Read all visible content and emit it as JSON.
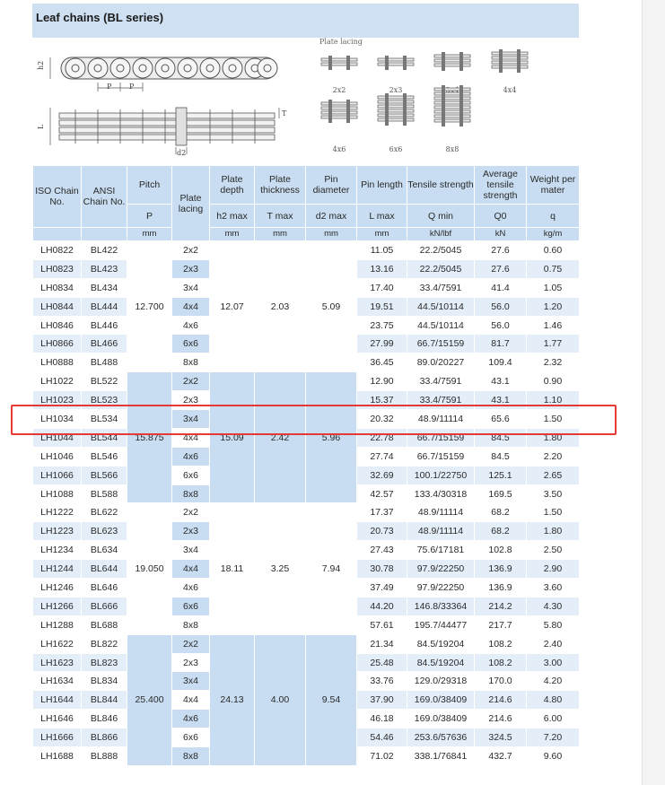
{
  "title": "Leaf chains (BL series)",
  "plate_lacing_title": "Plate lacing",
  "lacing_types": [
    "2x2",
    "2x3",
    "3x4",
    "4x4",
    "4x6",
    "6x6",
    "8x8"
  ],
  "dimension_labels": {
    "h2": "h2",
    "p1": "P",
    "p2": "P",
    "l": "L",
    "t": "T",
    "d2": "d2"
  },
  "headers": {
    "row1": [
      "ISO Chain No.",
      "ANSI Chain No.",
      "Pitch",
      "Plate lacing",
      "Plate depth",
      "Plate thickness",
      "Pin diameter",
      "Pin length",
      "Tensile strength",
      "Average tensile strength",
      "Weight per mater"
    ],
    "row2": [
      "P",
      "h2 max",
      "T max",
      "d2 max",
      "L max",
      "Q min",
      "Q0",
      "q"
    ],
    "units": [
      "mm",
      "mm",
      "mm",
      "mm",
      "mm",
      "kN/lbf",
      "kN",
      "kg/m"
    ]
  },
  "groups": [
    {
      "pitch": "12.700",
      "depth": "12.07",
      "thickness": "2.03",
      "diameter": "5.09",
      "rows": [
        {
          "iso": "LH0822",
          "ansi": "BL422",
          "lacing": "2x2",
          "length": "11.05",
          "q": "22.2/5045",
          "q0": "27.6",
          "w": "0.60"
        },
        {
          "iso": "LH0823",
          "ansi": "BL423",
          "lacing": "2x3",
          "length": "13.16",
          "q": "22.2/5045",
          "q0": "27.6",
          "w": "0.75"
        },
        {
          "iso": "LH0834",
          "ansi": "BL434",
          "lacing": "3x4",
          "length": "17.40",
          "q": "33.4/7591",
          "q0": "41.4",
          "w": "1.05"
        },
        {
          "iso": "LH0844",
          "ansi": "BL444",
          "lacing": "4x4",
          "length": "19.51",
          "q": "44.5/10114",
          "q0": "56.0",
          "w": "1.20"
        },
        {
          "iso": "LH0846",
          "ansi": "BL446",
          "lacing": "4x6",
          "length": "23.75",
          "q": "44.5/10114",
          "q0": "56.0",
          "w": "1.46"
        },
        {
          "iso": "LH0866",
          "ansi": "BL466",
          "lacing": "6x6",
          "length": "27.99",
          "q": "66.7/15159",
          "q0": "81.7",
          "w": "1.77"
        },
        {
          "iso": "LH0888",
          "ansi": "BL488",
          "lacing": "8x8",
          "length": "36.45",
          "q": "89.0/20227",
          "q0": "109.4",
          "w": "2.32"
        }
      ]
    },
    {
      "pitch": "15.875",
      "depth": "15.09",
      "thickness": "2.42",
      "diameter": "5.96",
      "rows": [
        {
          "iso": "LH1022",
          "ansi": "BL522",
          "lacing": "2x2",
          "length": "12.90",
          "q": "33.4/7591",
          "q0": "43.1",
          "w": "0.90"
        },
        {
          "iso": "LH1023",
          "ansi": "BL523",
          "lacing": "2x3",
          "length": "15.37",
          "q": "33.4/7591",
          "q0": "43.1",
          "w": "1.10"
        },
        {
          "iso": "LH1034",
          "ansi": "BL534",
          "lacing": "3x4",
          "length": "20.32",
          "q": "48.9/11114",
          "q0": "65.6",
          "w": "1.50"
        },
        {
          "iso": "LH1044",
          "ansi": "BL544",
          "lacing": "4x4",
          "length": "22.78",
          "q": "66.7/15159",
          "q0": "84.5",
          "w": "1.80"
        },
        {
          "iso": "LH1046",
          "ansi": "BL546",
          "lacing": "4x6",
          "length": "27.74",
          "q": "66.7/15159",
          "q0": "84.5",
          "w": "2.20"
        },
        {
          "iso": "LH1066",
          "ansi": "BL566",
          "lacing": "6x6",
          "length": "32.69",
          "q": "100.1/22750",
          "q0": "125.1",
          "w": "2.65"
        },
        {
          "iso": "LH1088",
          "ansi": "BL588",
          "lacing": "8x8",
          "length": "42.57",
          "q": "133.4/30318",
          "q0": "169.5",
          "w": "3.50"
        }
      ]
    },
    {
      "pitch": "19.050",
      "depth": "18.11",
      "thickness": "3.25",
      "diameter": "7.94",
      "rows": [
        {
          "iso": "LH1222",
          "ansi": "BL622",
          "lacing": "2x2",
          "length": "17.37",
          "q": "48.9/11114",
          "q0": "68.2",
          "w": "1.50"
        },
        {
          "iso": "LH1223",
          "ansi": "BL623",
          "lacing": "2x3",
          "length": "20.73",
          "q": "48.9/11114",
          "q0": "68.2",
          "w": "1.80"
        },
        {
          "iso": "LH1234",
          "ansi": "BL634",
          "lacing": "3x4",
          "length": "27.43",
          "q": "75.6/17181",
          "q0": "102.8",
          "w": "2.50"
        },
        {
          "iso": "LH1244",
          "ansi": "BL644",
          "lacing": "4x4",
          "length": "30.78",
          "q": "97.9/22250",
          "q0": "136.9",
          "w": "2.90"
        },
        {
          "iso": "LH1246",
          "ansi": "BL646",
          "lacing": "4x6",
          "length": "37.49",
          "q": "97.9/22250",
          "q0": "136.9",
          "w": "3.60"
        },
        {
          "iso": "LH1266",
          "ansi": "BL666",
          "lacing": "6x6",
          "length": "44.20",
          "q": "146.8/33364",
          "q0": "214.2",
          "w": "4.30"
        },
        {
          "iso": "LH1288",
          "ansi": "BL688",
          "lacing": "8x8",
          "length": "57.61",
          "q": "195.7/44477",
          "q0": "217.7",
          "w": "5.80"
        }
      ]
    },
    {
      "pitch": "25.400",
      "depth": "24.13",
      "thickness": "4.00",
      "diameter": "9.54",
      "rows": [
        {
          "iso": "LH1622",
          "ansi": "BL822",
          "lacing": "2x2",
          "length": "21.34",
          "q": "84.5/19204",
          "q0": "108.2",
          "w": "2.40"
        },
        {
          "iso": "LH1623",
          "ansi": "BL823",
          "lacing": "2x3",
          "length": "25.48",
          "q": "84.5/19204",
          "q0": "108.2",
          "w": "3.00"
        },
        {
          "iso": "LH1634",
          "ansi": "BL834",
          "lacing": "3x4",
          "length": "33.76",
          "q": "129.0/29318",
          "q0": "170.0",
          "w": "4.20"
        },
        {
          "iso": "LH1644",
          "ansi": "BL844",
          "lacing": "4x4",
          "length": "37.90",
          "q": "169.0/38409",
          "q0": "214.6",
          "w": "4.80"
        },
        {
          "iso": "LH1646",
          "ansi": "BL846",
          "lacing": "4x6",
          "length": "46.18",
          "q": "169.0/38409",
          "q0": "214.6",
          "w": "6.00"
        },
        {
          "iso": "LH1666",
          "ansi": "BL866",
          "lacing": "6x6",
          "length": "54.46",
          "q": "253.6/57636",
          "q0": "324.5",
          "w": "7.20"
        },
        {
          "iso": "LH1688",
          "ansi": "BL888",
          "lacing": "8x8",
          "length": "71.02",
          "q": "338.1/76841",
          "q0": "432.7",
          "w": "9.60"
        }
      ]
    }
  ],
  "colors": {
    "header_blue": "#c8ddf1",
    "stripe_blue": "#e4eef9",
    "highlight_red": "#e53935"
  }
}
